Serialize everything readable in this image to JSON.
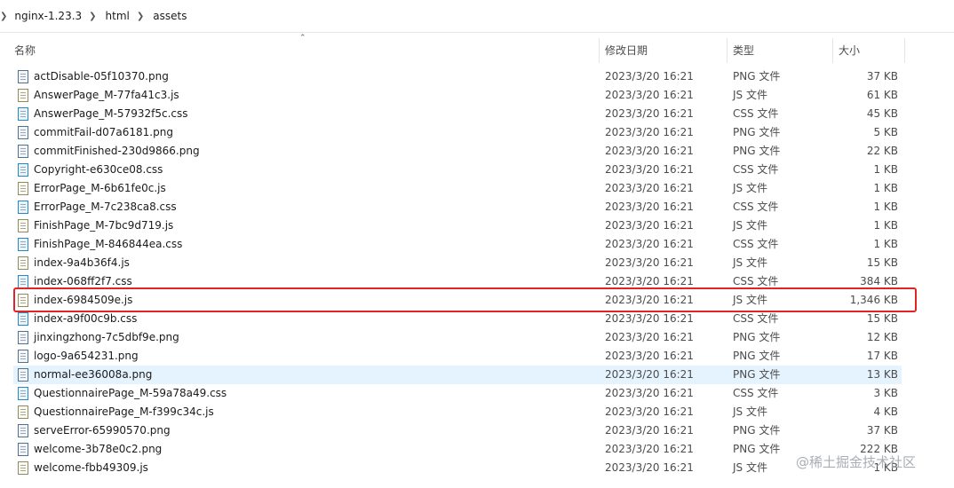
{
  "breadcrumb": [
    "nginx-1.23.3",
    "html",
    "assets"
  ],
  "columns": {
    "name": "名称",
    "date": "修改日期",
    "type": "类型",
    "size": "大小"
  },
  "files": [
    {
      "name": "actDisable-05f10370.png",
      "date": "2023/3/20 16:21",
      "type": "PNG 文件",
      "size": "37 KB",
      "icon": "png-file-icon"
    },
    {
      "name": "AnswerPage_M-77fa41c3.js",
      "date": "2023/3/20 16:21",
      "type": "JS 文件",
      "size": "61 KB",
      "icon": "js-file-icon"
    },
    {
      "name": "AnswerPage_M-57932f5c.css",
      "date": "2023/3/20 16:21",
      "type": "CSS 文件",
      "size": "45 KB",
      "icon": "css-file-icon"
    },
    {
      "name": "commitFail-d07a6181.png",
      "date": "2023/3/20 16:21",
      "type": "PNG 文件",
      "size": "5 KB",
      "icon": "png-file-icon"
    },
    {
      "name": "commitFinished-230d9866.png",
      "date": "2023/3/20 16:21",
      "type": "PNG 文件",
      "size": "22 KB",
      "icon": "png-file-icon"
    },
    {
      "name": "Copyright-e630ce08.css",
      "date": "2023/3/20 16:21",
      "type": "CSS 文件",
      "size": "1 KB",
      "icon": "css-file-icon"
    },
    {
      "name": "ErrorPage_M-6b61fe0c.js",
      "date": "2023/3/20 16:21",
      "type": "JS 文件",
      "size": "1 KB",
      "icon": "js-file-icon"
    },
    {
      "name": "ErrorPage_M-7c238ca8.css",
      "date": "2023/3/20 16:21",
      "type": "CSS 文件",
      "size": "1 KB",
      "icon": "css-file-icon"
    },
    {
      "name": "FinishPage_M-7bc9d719.js",
      "date": "2023/3/20 16:21",
      "type": "JS 文件",
      "size": "1 KB",
      "icon": "js-file-icon"
    },
    {
      "name": "FinishPage_M-846844ea.css",
      "date": "2023/3/20 16:21",
      "type": "CSS 文件",
      "size": "1 KB",
      "icon": "css-file-icon"
    },
    {
      "name": "index-9a4b36f4.js",
      "date": "2023/3/20 16:21",
      "type": "JS 文件",
      "size": "15 KB",
      "icon": "js-file-icon"
    },
    {
      "name": "index-068ff2f7.css",
      "date": "2023/3/20 16:21",
      "type": "CSS 文件",
      "size": "384 KB",
      "icon": "css-file-icon"
    },
    {
      "name": "index-6984509e.js",
      "date": "2023/3/20 16:21",
      "type": "JS 文件",
      "size": "1,346 KB",
      "icon": "js-file-icon"
    },
    {
      "name": "index-a9f00c9b.css",
      "date": "2023/3/20 16:21",
      "type": "CSS 文件",
      "size": "15 KB",
      "icon": "css-file-icon"
    },
    {
      "name": "jinxingzhong-7c5dbf9e.png",
      "date": "2023/3/20 16:21",
      "type": "PNG 文件",
      "size": "12 KB",
      "icon": "png-file-icon"
    },
    {
      "name": "logo-9a654231.png",
      "date": "2023/3/20 16:21",
      "type": "PNG 文件",
      "size": "17 KB",
      "icon": "png-file-icon"
    },
    {
      "name": "normal-ee36008a.png",
      "date": "2023/3/20 16:21",
      "type": "PNG 文件",
      "size": "13 KB",
      "icon": "png-file-icon"
    },
    {
      "name": "QuestionnairePage_M-59a78a49.css",
      "date": "2023/3/20 16:21",
      "type": "CSS 文件",
      "size": "3 KB",
      "icon": "css-file-icon"
    },
    {
      "name": "QuestionnairePage_M-f399c34c.js",
      "date": "2023/3/20 16:21",
      "type": "JS 文件",
      "size": "4 KB",
      "icon": "js-file-icon"
    },
    {
      "name": "serveError-65990570.png",
      "date": "2023/3/20 16:21",
      "type": "PNG 文件",
      "size": "37 KB",
      "icon": "png-file-icon"
    },
    {
      "name": "welcome-3b78e0c2.png",
      "date": "2023/3/20 16:21",
      "type": "PNG 文件",
      "size": "222 KB",
      "icon": "png-file-icon"
    },
    {
      "name": "welcome-fbb49309.js",
      "date": "2023/3/20 16:21",
      "type": "JS 文件",
      "size": "1 KB",
      "icon": "js-file-icon"
    }
  ],
  "hover_index": 16,
  "highlight_index": 12,
  "colors": {
    "hover": "#e5f3ff",
    "highlight_border": "#e12525"
  },
  "watermark": "@稀土掘金技术社区"
}
